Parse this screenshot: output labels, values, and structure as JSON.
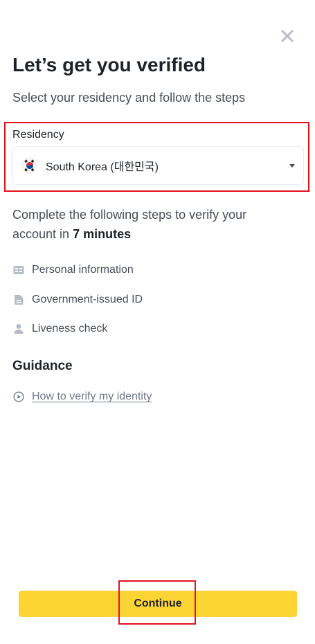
{
  "header": {
    "close_icon": "close-icon",
    "title": "Let’s get you verified",
    "subtitle": "Select your residency and follow the steps"
  },
  "residency": {
    "label": "Residency",
    "selected_value": "South Korea (대한민국)",
    "flag_icon": "south-korea-flag-icon",
    "dropdown_icon": "caret-down-icon"
  },
  "description": {
    "text_before": "Complete the following steps to verify your account in ",
    "time": "7 minutes"
  },
  "steps": [
    {
      "icon": "id-card-icon",
      "label": "Personal information"
    },
    {
      "icon": "document-icon",
      "label": "Government-issued ID"
    },
    {
      "icon": "person-icon",
      "label": "Liveness check"
    }
  ],
  "guidance": {
    "title": "Guidance",
    "link_icon": "play-circle-icon",
    "link_label": "How to verify my identity"
  },
  "footer": {
    "continue_label": "Continue"
  },
  "colors": {
    "accent": "#fcd535",
    "highlight": "#e5101c",
    "text_primary": "#1e2329",
    "text_secondary": "#474d57",
    "icon_gray": "#b7bdc6"
  }
}
